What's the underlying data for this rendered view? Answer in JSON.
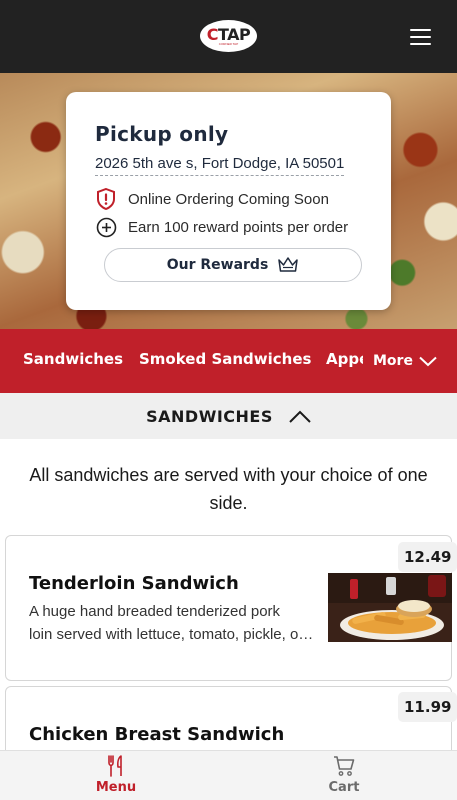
{
  "header": {
    "logo_text_first": "C",
    "logo_text_rest": "TAP",
    "logo_tagline": "CORNER TAP",
    "menu_icon": "hamburger-menu-icon"
  },
  "info_card": {
    "title": "Pickup only",
    "address": "2026 5th ave s, Fort Dodge, IA 50501",
    "notice": "Online Ordering Coming Soon",
    "notice_icon": "shield-alert-icon",
    "rewards_info": "Earn 100 reward points per order",
    "rewards_info_icon": "plus-circle-icon",
    "rewards_button": "Our Rewards",
    "rewards_button_icon": "crown-icon"
  },
  "categories": {
    "items": [
      "Sandwiches",
      "Smoked Sandwiches",
      "Appetizers"
    ],
    "more_label": "More",
    "more_icon": "chevron-down-icon"
  },
  "section": {
    "title": "SANDWICHES",
    "toggle_icon": "chevron-up-icon",
    "description": "All sandwiches are served with your choice of one side."
  },
  "menu_items": [
    {
      "name": "Tenderloin Sandwich",
      "price": "12.49",
      "description_line1": "A huge hand breaded tenderized pork",
      "description_line2": "loin served with lettuce, tomato, pickle, onion"
    },
    {
      "name": "Chicken Breast Sandwich",
      "price": "11.99"
    }
  ],
  "bottom_nav": {
    "menu_label": "Menu",
    "menu_icon": "fork-knife-icon",
    "cart_label": "Cart",
    "cart_icon": "cart-icon"
  },
  "colors": {
    "brand_red": "#c0202a",
    "header_dark": "#222222",
    "navy_text": "#1f2a3d",
    "inactive_gray": "#6b6b6b"
  }
}
